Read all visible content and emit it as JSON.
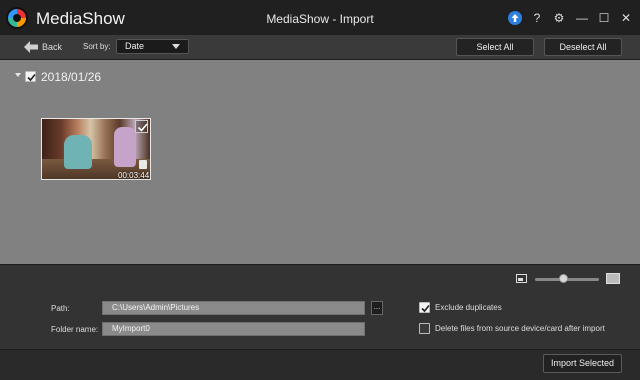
{
  "window": {
    "app_name": "MediaShow",
    "title": "MediaShow - Import",
    "help_label": "?",
    "settings_glyph": "⚙",
    "minimize_glyph": "—",
    "maximize_glyph": "☐",
    "close_glyph": "✕"
  },
  "toolbar": {
    "back_label": "Back",
    "sort_label": "Sort by:",
    "sort_value": "Date",
    "select_all_label": "Select All",
    "deselect_all_label": "Deselect All"
  },
  "group": {
    "date": "2018/01/26",
    "checked": true,
    "items": [
      {
        "duration": "00:03:44",
        "checked": true,
        "type_icon": "video-icon"
      }
    ]
  },
  "zoom": {
    "level": 0.45
  },
  "import_options": {
    "path_label": "Path:",
    "path_value": "C:\\Users\\Admin\\Pictures",
    "browse_label": "...",
    "folder_label": "Folder name:",
    "folder_value": "MyImport0",
    "exclude_duplicates_label": "Exclude duplicates",
    "exclude_duplicates_checked": true,
    "delete_after_label": "Delete files from source device/card after import",
    "delete_after_checked": false
  },
  "footer": {
    "import_label": "Import Selected"
  },
  "colors": {
    "accent": "#2f7fe0",
    "main_bg": "#818181",
    "panel_bg": "#333333"
  }
}
